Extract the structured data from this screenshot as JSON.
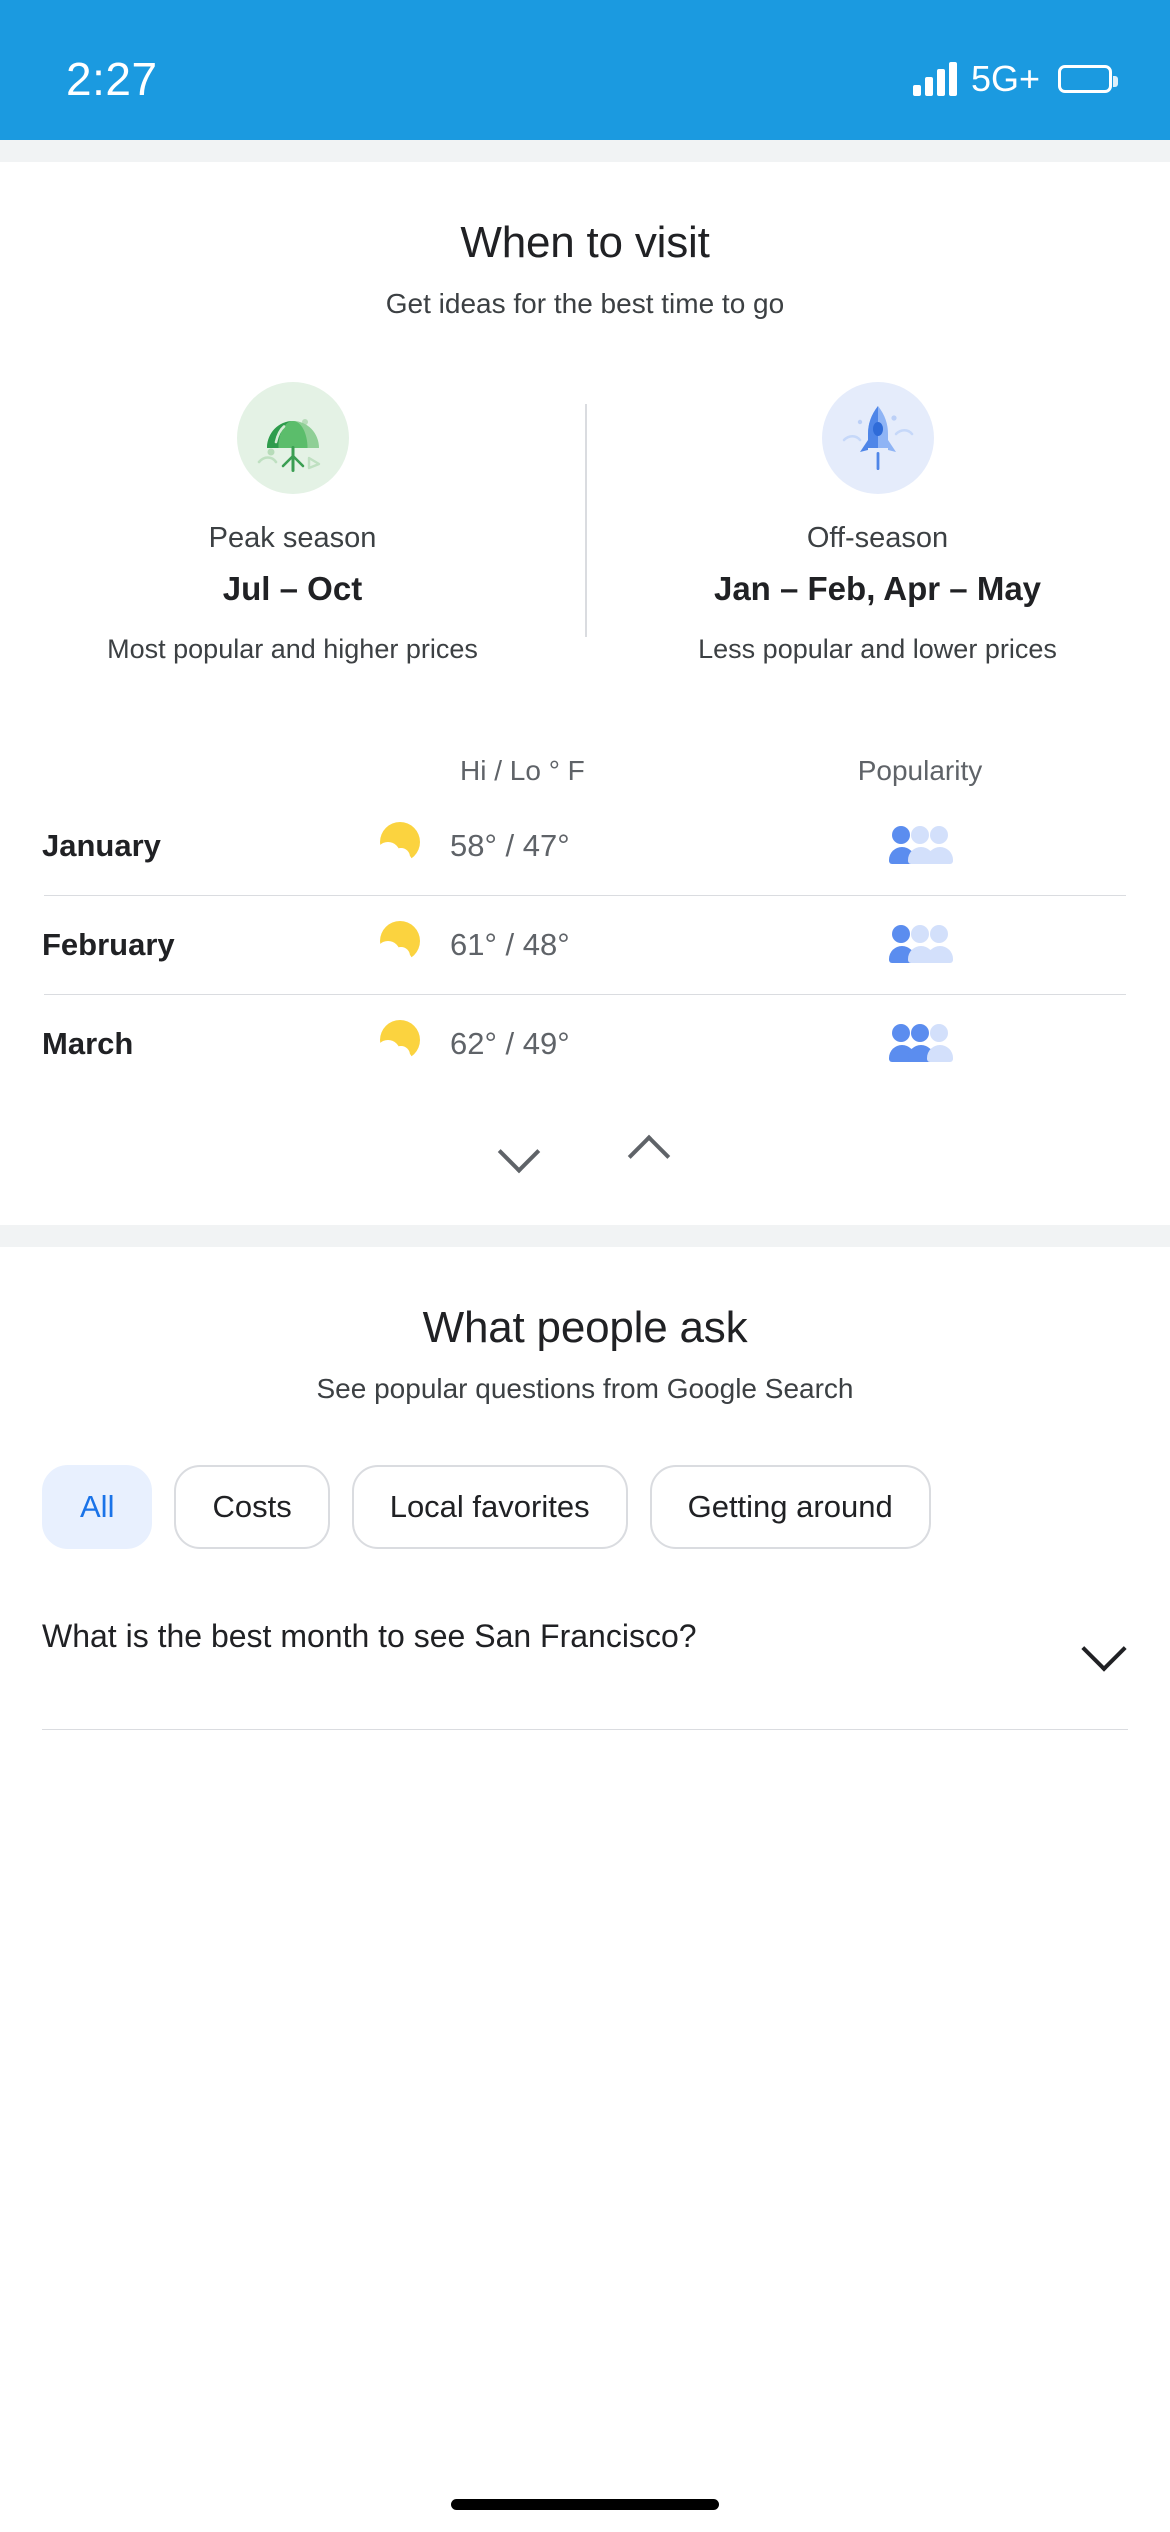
{
  "status_bar": {
    "time": "2:27",
    "network": "5G+",
    "signal_icon": "signal-bars-icon",
    "battery_icon": "battery-icon"
  },
  "when_to_visit": {
    "title": "When to visit",
    "subtitle": "Get ideas for the best time to go",
    "seasons": [
      {
        "icon": "umbrella-icon",
        "label": "Peak season",
        "range": "Jul – Oct",
        "description": "Most popular and higher prices"
      },
      {
        "icon": "rocket-icon",
        "label": "Off-season",
        "range": "Jan – Feb, Apr – May",
        "description": "Less popular and lower prices"
      }
    ],
    "table": {
      "headers": {
        "month": "",
        "temp": "Hi / Lo ° F",
        "popularity": "Popularity"
      },
      "rows": [
        {
          "month": "January",
          "weather_icon": "partly-sunny-icon",
          "high": "58°",
          "low": "47°",
          "temp": "58° / 47°",
          "popularity_filled": 1,
          "popularity_total": 3
        },
        {
          "month": "February",
          "weather_icon": "partly-sunny-icon",
          "high": "61°",
          "low": "48°",
          "temp": "61° / 48°",
          "popularity_filled": 1,
          "popularity_total": 3
        },
        {
          "month": "March",
          "weather_icon": "partly-sunny-icon",
          "high": "62°",
          "low": "49°",
          "temp": "62° / 49°",
          "popularity_filled": 2,
          "popularity_total": 3
        }
      ]
    },
    "expand_icon": "chevron-down-icon",
    "collapse_icon": "chevron-up-icon"
  },
  "what_people_ask": {
    "title": "What people ask",
    "subtitle": "See popular questions from Google Search",
    "chips": [
      {
        "label": "All",
        "active": true
      },
      {
        "label": "Costs",
        "active": false
      },
      {
        "label": "Local favorites",
        "active": false
      },
      {
        "label": "Getting around",
        "active": false
      }
    ],
    "questions": [
      {
        "text": "What is the best month to see San Francisco?",
        "expand_icon": "chevron-down-icon"
      }
    ]
  },
  "colors": {
    "status_bar": "#1b9ae0",
    "accent_blue": "#1a73e8",
    "chip_active_bg": "#e8f0fe",
    "peak_circle": "#e4f2e5",
    "off_circle": "#e5ecfb",
    "sun": "#fbd33f",
    "person_on": "#5b8def",
    "person_off": "#d3e0fb"
  }
}
